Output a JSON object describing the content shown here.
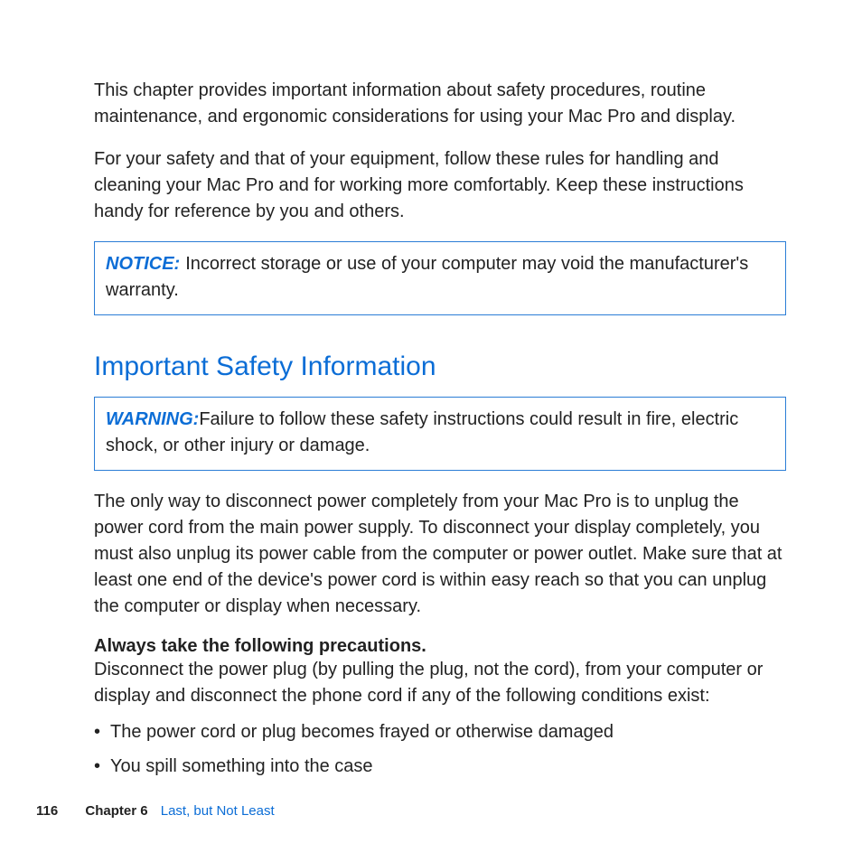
{
  "intro": {
    "p1": "This chapter provides important information about safety procedures, routine maintenance, and ergonomic considerations for using your Mac Pro and display.",
    "p2": "For your safety and that of your equipment, follow these rules for handling and cleaning your Mac Pro and for working more comfortably. Keep these instructions handy for reference by you and others."
  },
  "notice": {
    "label": "NOTICE:",
    "text": "Incorrect storage or use of your computer may void the manufacturer's warranty."
  },
  "section": {
    "heading": "Important Safety Information"
  },
  "warning": {
    "label": "WARNING:",
    "text": "Failure to follow these safety instructions could result in fire, electric shock, or other injury or damage."
  },
  "body": {
    "p1": "The only way to disconnect power completely from your Mac Pro is to unplug the power cord from the main power supply. To disconnect your display completely, you must also unplug its power cable from the computer or power outlet. Make sure that at least one end of the device's power cord is within easy reach so that you can unplug the computer or display when necessary.",
    "subheading": "Always take the following precautions.",
    "p2": "Disconnect the power plug (by pulling the plug, not the cord), from your computer or display and disconnect the phone cord if any of the following conditions exist:",
    "bullets": [
      "The power cord or plug becomes frayed or otherwise damaged",
      "You spill something into the case"
    ]
  },
  "footer": {
    "page": "116",
    "chapter_label": "Chapter 6",
    "chapter_title": "Last, but Not Least"
  }
}
